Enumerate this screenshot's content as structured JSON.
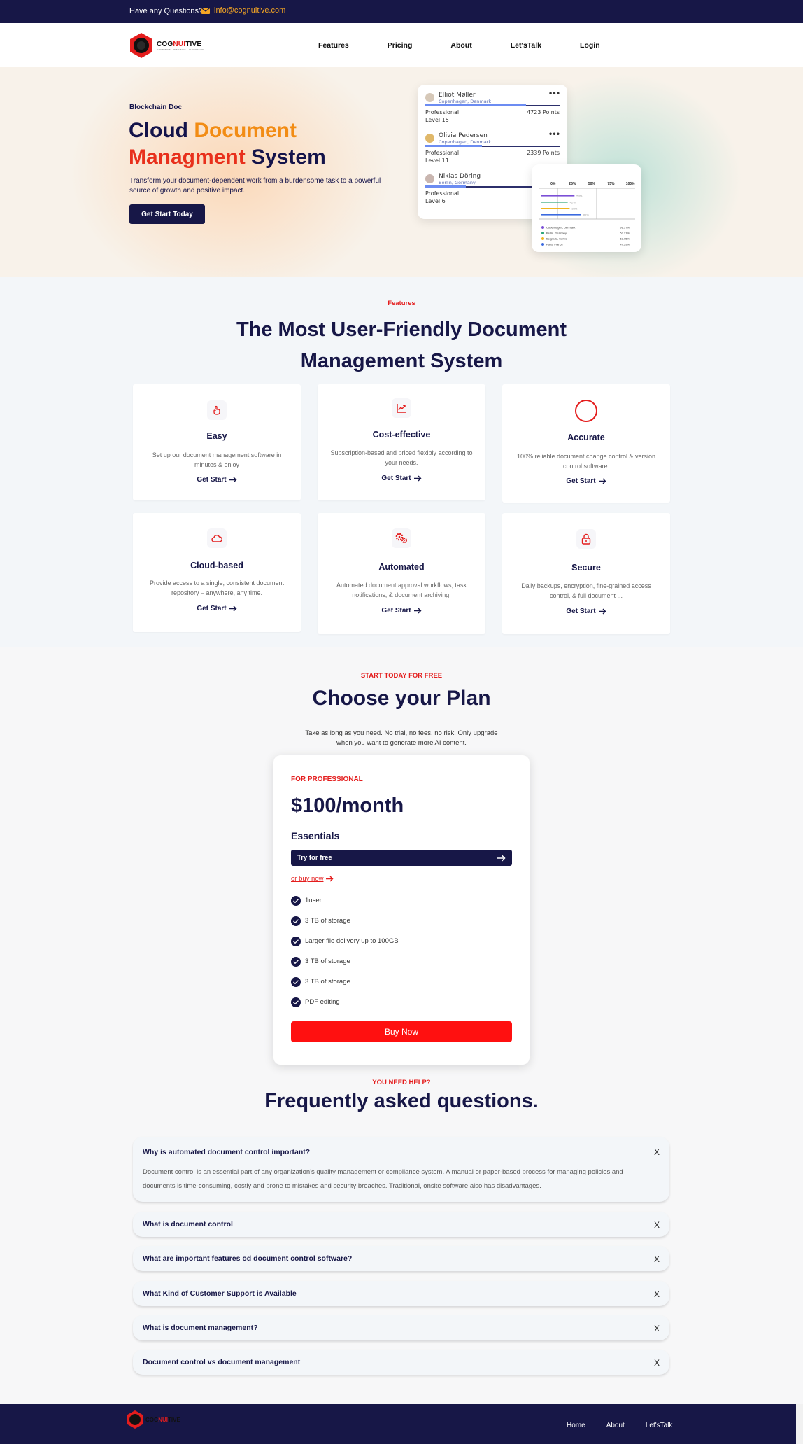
{
  "topbar": {
    "question": "Have any Questions?",
    "email": "info@cognuitive.com",
    "bg": "#171747",
    "email_color": "#f5a623"
  },
  "brand": {
    "name_part1": "COG",
    "name_part2": "NUI",
    "name_part3": "TIVE",
    "tagline": "COGNITIVE · INTUITIVE · INNOVATIVE"
  },
  "nav": {
    "items": [
      "Features",
      "Pricing",
      "About",
      "Let'sTalk",
      "Login"
    ]
  },
  "hero": {
    "kicker": "Blockchain Doc",
    "title_1": "Cloud ",
    "title_2": "Document",
    "title_3": "Managment",
    "title_4": " System",
    "subtitle": "Transform your document-dependent work from a burdensome task to a powerful source of growth and positive impact.",
    "cta": "Get Start Today"
  },
  "leaderboard": [
    {
      "name": "Elliot Møller",
      "location": "Copenhagen, Denmark",
      "role": "Professional",
      "points": "4723 Points",
      "level": "Level 15",
      "progress": 0.75
    },
    {
      "name": "Olivia Pedersen",
      "location": "Copenhagen, Denmark",
      "role": "Professional",
      "points": "2339 Points",
      "level": "Level 11",
      "progress": 0.42
    },
    {
      "name": "Niklas Döring",
      "location": "Berlin, Germany",
      "role": "Professional",
      "points": "1",
      "level": "Level 6",
      "progress": 0.3
    }
  ],
  "mini_chart": {
    "ticks": [
      "0%",
      "25%",
      "50%",
      "75%",
      "100%"
    ],
    "bars": [
      {
        "label": "Copenhagen, Denmark",
        "value": 35,
        "pct": "91.57%",
        "color": "#7b4fd6"
      },
      {
        "label": "Berlin, Germany",
        "value": 28,
        "pct": "63.21%",
        "color": "#2ea67a"
      },
      {
        "label": "Belgrade, Serbia",
        "value": 30,
        "pct": "52.95%",
        "color": "#f1b51c"
      },
      {
        "label": "Paris, France",
        "value": 42,
        "pct": "47.29%",
        "color": "#3b6ae0"
      }
    ],
    "bar_labels": [
      "53%",
      "42%",
      "38%",
      "61%"
    ]
  },
  "features": {
    "kicker": "Features",
    "title_line1": "The Most User-Friendly Document",
    "title_line2": "Management System",
    "link_label": "Get Start",
    "cards": [
      {
        "title": "Easy",
        "desc": "Set up our document management software in minutes & enjoy",
        "icon": "hand-pointer-icon"
      },
      {
        "title": "Cost-effective",
        "desc": "Subscription-based and priced flexibly according to your needs.",
        "icon": "trend-chart-icon"
      },
      {
        "title": "Accurate",
        "desc": "100% reliable document change control & version control software.",
        "icon": "circle-target-icon"
      },
      {
        "title": "Cloud-based",
        "desc": "Provide access to a single, consistent document repository – anywhere, any time.",
        "icon": "cloud-icon"
      },
      {
        "title": "Automated",
        "desc": "Automated document approval workflows, task notifications, & document archiving.",
        "icon": "gears-icon"
      },
      {
        "title": "Secure",
        "desc": "Daily backups, encryption, fine-grained access control, & full document ...",
        "icon": "lock-icon"
      }
    ]
  },
  "pricing": {
    "kicker": "START TODAY FOR FREE",
    "title": "Choose your Plan",
    "lead": "Take as long as you need. No trial, no fees, no risk. Only upgrade when you want to generate more AI content.",
    "plan": {
      "for": "FOR PROFESSIONAL",
      "price": "$100/month",
      "name": "Essentials",
      "try": "Try for free",
      "buy_link": "or buy now",
      "features": [
        "1user",
        "3 TB of storage",
        "Larger file delivery up to 100GB",
        "3 TB of storage",
        "3 TB of storage",
        "PDF editing"
      ],
      "buy_now": "Buy Now"
    }
  },
  "faq": {
    "kicker": "YOU NEED HELP?",
    "title": "Frequently asked questions.",
    "items": [
      {
        "q": "Why is automated document control important?",
        "a": "Document control is an essential part of any organization's quality management or compliance system. A manual or paper-based process for managing policies and documents is time-consuming, costly and prone to mistakes and security breaches. Traditional, onsite software also has disadvantages.",
        "toggle": "X"
      },
      {
        "q": "What is document control",
        "toggle": "X"
      },
      {
        "q": "What are important features od document control software?",
        "toggle": "X"
      },
      {
        "q": "What Kind of Customer Support is Available",
        "toggle": "X"
      },
      {
        "q": "What is document management?",
        "toggle": "X"
      },
      {
        "q": "Document control vs document management",
        "toggle": "X"
      }
    ]
  },
  "footer": {
    "links": [
      "Home",
      "About",
      "Let'sTalk"
    ]
  },
  "colors": {
    "navy": "#171747",
    "red": "#e41d1d",
    "orange": "#f28c14",
    "buy": "#ff1010"
  }
}
